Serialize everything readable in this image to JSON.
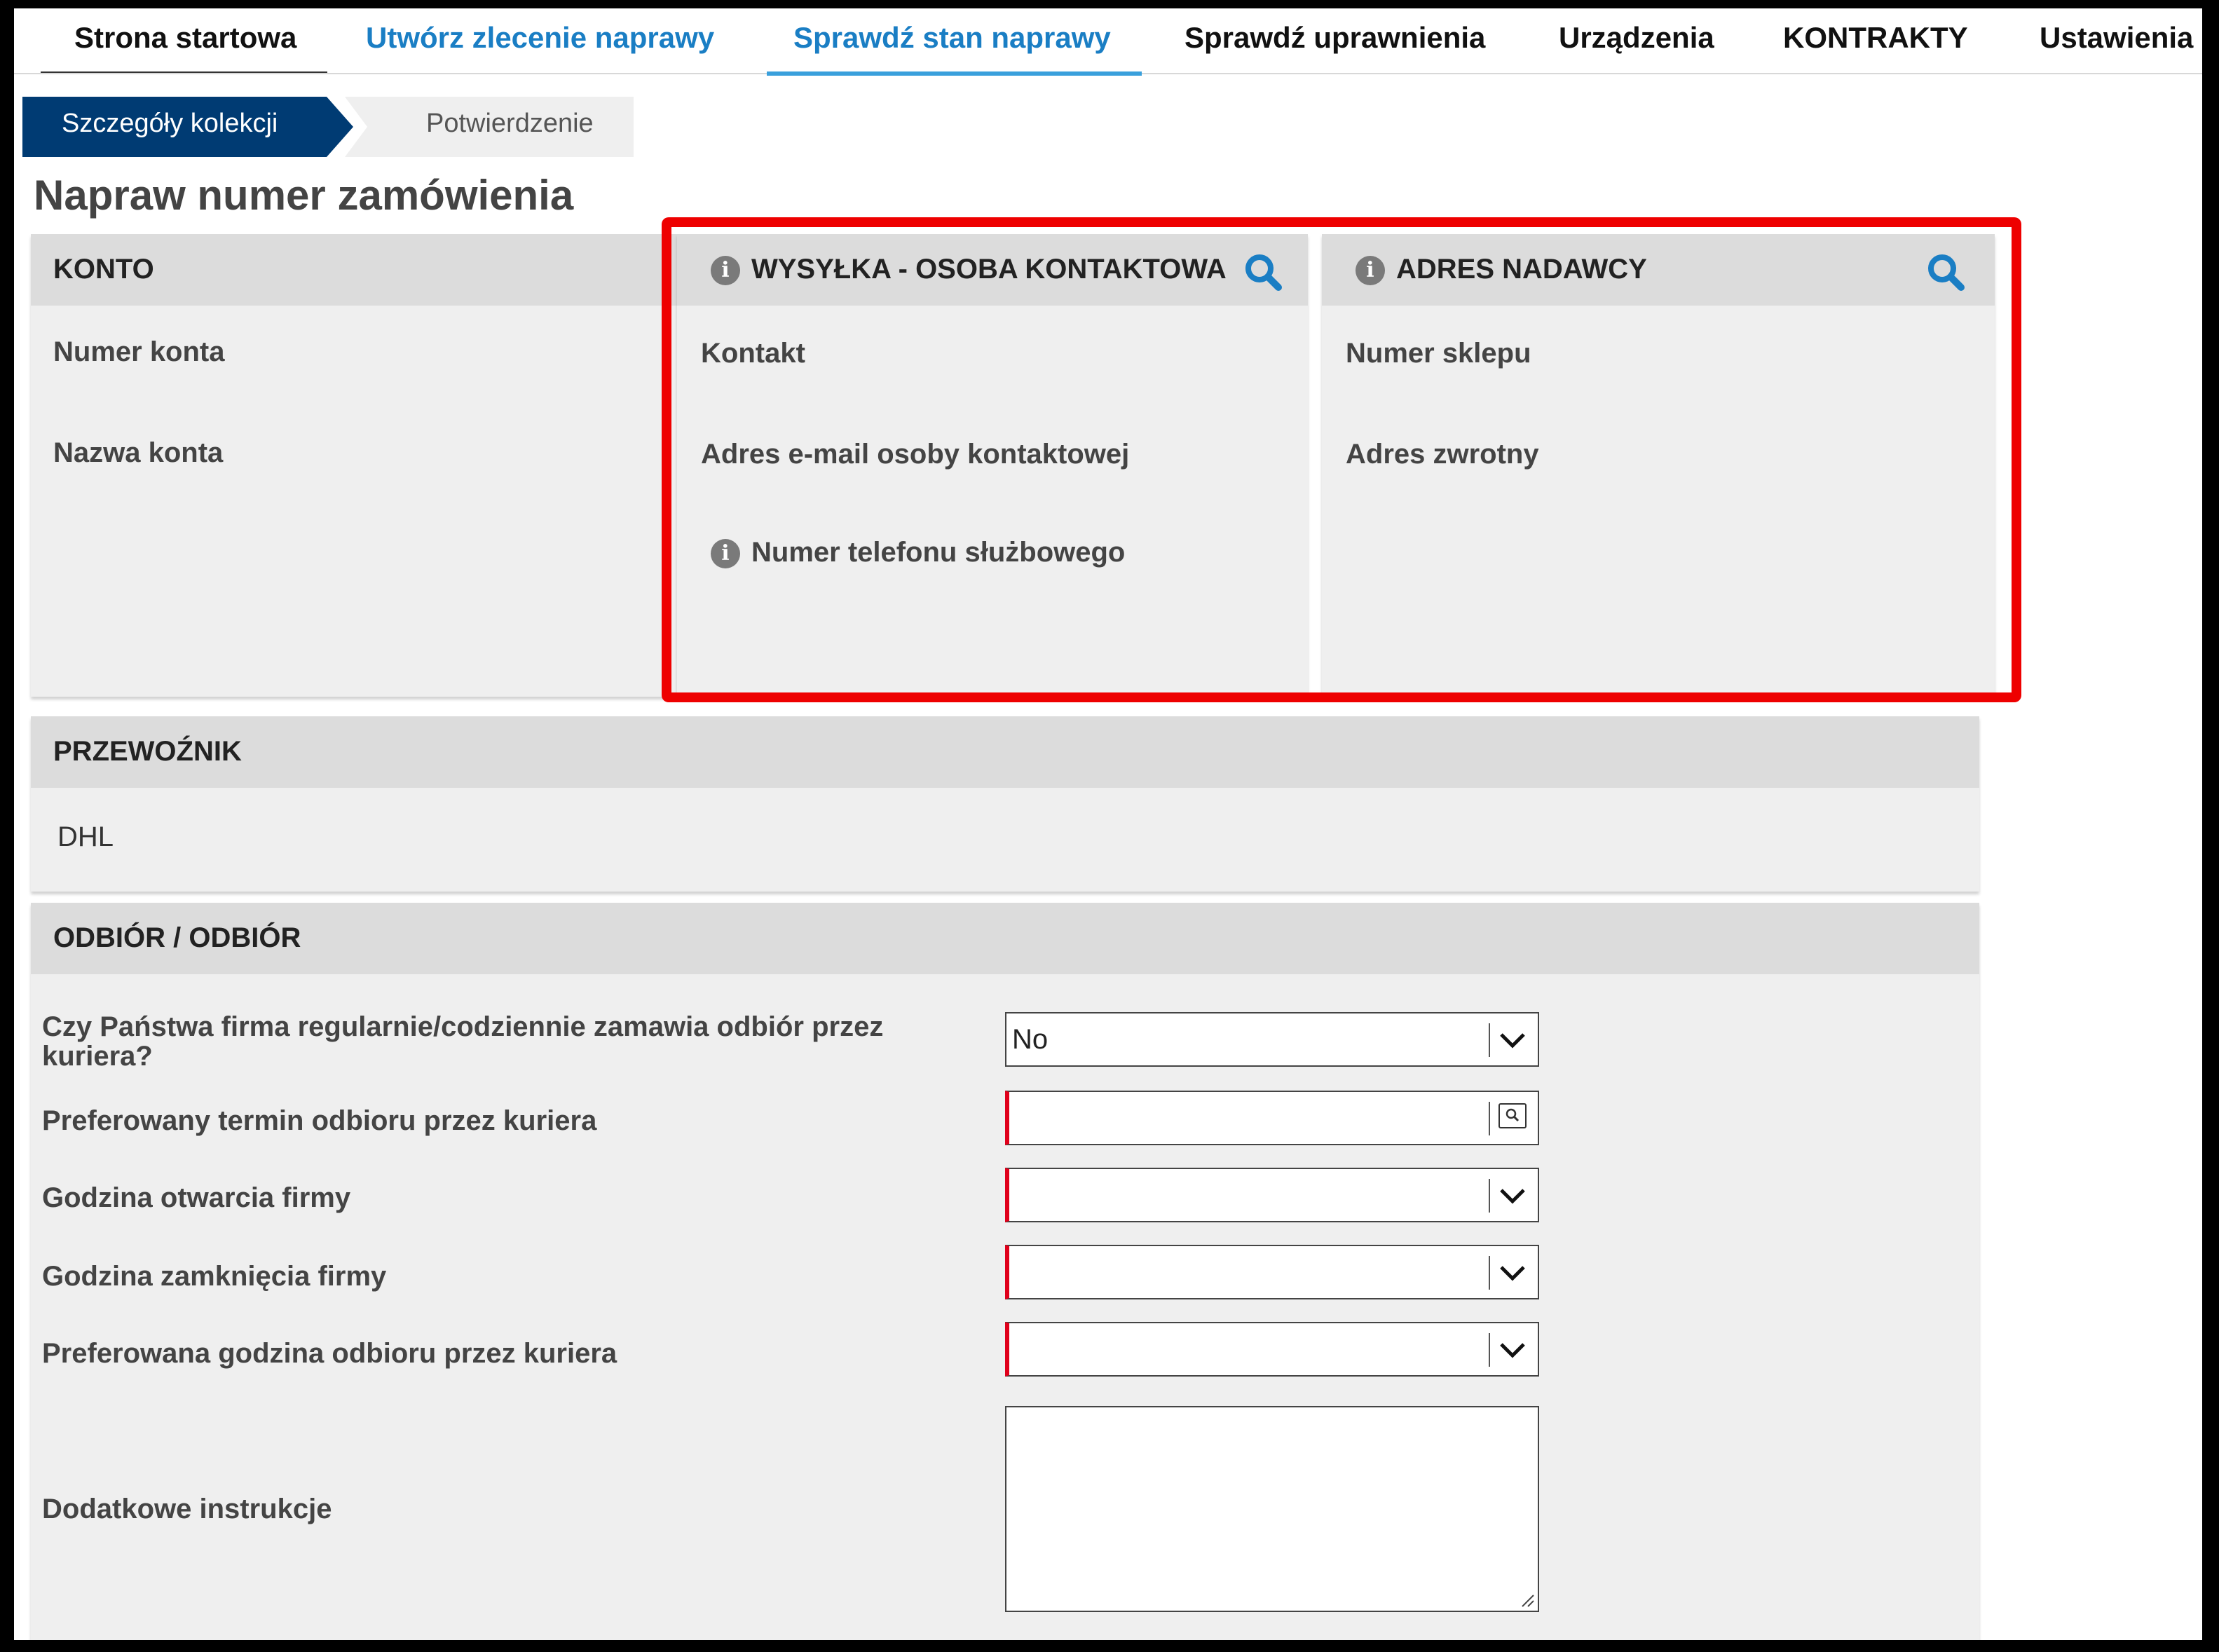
{
  "nav": {
    "items": [
      "Strona startowa",
      "Utwórz zlecenie naprawy",
      "Sprawdź stan naprawy",
      "Sprawdź uprawnienia",
      "Urządzenia",
      "KONTRAKTY",
      "Ustawienia"
    ],
    "active_index": 2
  },
  "wizard": {
    "step1": "Szczegóły kolekcji",
    "step2": "Potwierdzenie"
  },
  "page_title": "Napraw numer zamówienia",
  "konto": {
    "title": "KONTO",
    "fields": [
      "Numer konta",
      "Nazwa konta"
    ]
  },
  "wysylka": {
    "title": "WYSYŁKA - OSOBA KONTAKTOWA",
    "fields": [
      "Kontakt",
      "Adres e-mail osoby kontaktowej",
      "Numer telefonu służbowego"
    ]
  },
  "adres": {
    "title": "ADRES NADAWCY",
    "fields": [
      "Numer sklepu",
      "Adres zwrotny"
    ]
  },
  "przewoznik": {
    "title": "PRZEWOŹNIK",
    "value": "DHL"
  },
  "odbior": {
    "title": "ODBIÓR / ODBIÓR",
    "q_regular": "Czy Państwa firma regularnie/codziennie zamawia odbiór przez kuriera?",
    "q_regular_value": "No",
    "q_date": "Preferowany termin odbioru przez kuriera",
    "q_open": "Godzina otwarcia firmy",
    "q_close": "Godzina zamknięcia firmy",
    "q_time": "Preferowana godzina odbioru przez kuriera",
    "q_instructions": "Dodatkowe instrukcje"
  },
  "colors": {
    "nav_active": "#1a7ec4",
    "wizard_active": "#003b73",
    "highlight": "#ee0000",
    "icon": "#1a7ec4",
    "required": "#e0001b"
  },
  "icons": [
    "info-icon",
    "search-icon",
    "chevron-down-icon",
    "calendar-icon",
    "resize-grip-icon"
  ]
}
